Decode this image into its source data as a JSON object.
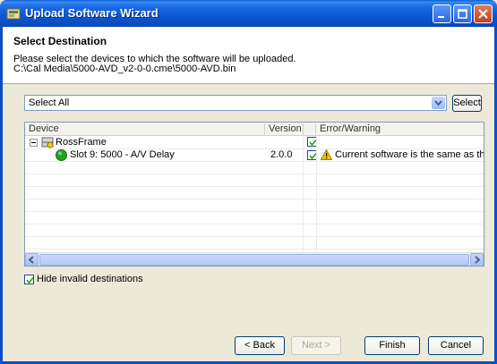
{
  "window": {
    "title": "Upload Software Wizard",
    "icon": "wizard-app-icon"
  },
  "header": {
    "title": "Select Destination",
    "description": "Please select the devices to which the software will be uploaded.",
    "file_path": "C:\\Cal Media\\5000-AVD_v2-0-0.cme\\5000-AVD.bin"
  },
  "selector": {
    "value": "Select All",
    "button_label": "Select"
  },
  "table": {
    "columns": [
      "Device",
      "Version",
      "",
      "Error/Warning"
    ],
    "rows": [
      {
        "device": "RossFrame",
        "version": "",
        "checked": true,
        "message": "",
        "icon": "rossframe-icon"
      },
      {
        "device": "Slot 9: 5000 - A/V Delay",
        "version": "2.0.0",
        "checked": true,
        "message": "Current software is the same as the up",
        "icon": "status-ok-icon",
        "warning_icon": "warning-icon"
      }
    ]
  },
  "options": {
    "hide_invalid_label": "Hide invalid destinations",
    "hide_invalid_checked": true
  },
  "buttons": {
    "back": "< Back",
    "next": "Next >",
    "finish": "Finish",
    "cancel": "Cancel"
  },
  "colors": {
    "titlebar": "#0a5fd6",
    "status_ok": "#22a022",
    "warning": "#f5c400"
  }
}
